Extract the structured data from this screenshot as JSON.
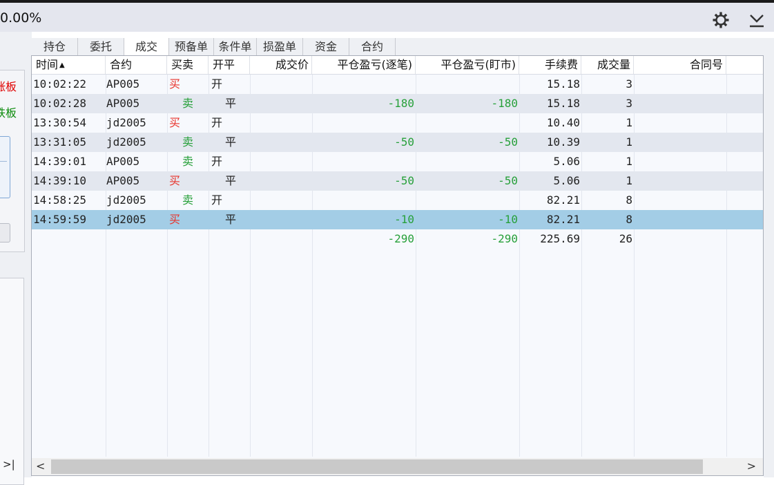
{
  "header": {
    "percent": "0.00%"
  },
  "left_panel": {
    "limit_up": "涨板",
    "limit_down": "跌板",
    "bottom_glyph": ">|"
  },
  "tabs": [
    {
      "label": "持仓",
      "active": false
    },
    {
      "label": "委托",
      "active": false
    },
    {
      "label": "成交",
      "active": true
    },
    {
      "label": "预备单",
      "active": false
    },
    {
      "label": "条件单",
      "active": false
    },
    {
      "label": "损盈单",
      "active": false
    },
    {
      "label": "资金",
      "active": false
    },
    {
      "label": "合约",
      "active": false
    }
  ],
  "table": {
    "columns": [
      "时间",
      "合约",
      "买卖",
      "开平",
      "成交价",
      "平仓盈亏(逐笔)",
      "平仓盈亏(盯市)",
      "手续费",
      "成交量",
      "合同号"
    ],
    "sort_indicator": "▲",
    "rows": [
      {
        "time": "10:02:22",
        "contract": "AP005",
        "side": "买",
        "open_close": "开",
        "price": "",
        "pl_trade": "",
        "pl_mark": "",
        "fee": "15.18",
        "volume": "3",
        "order_no": ""
      },
      {
        "time": "10:02:28",
        "contract": "AP005",
        "side": "卖",
        "open_close": "平",
        "price": "",
        "pl_trade": "-180",
        "pl_mark": "-180",
        "fee": "15.18",
        "volume": "3",
        "order_no": ""
      },
      {
        "time": "13:30:54",
        "contract": "jd2005",
        "side": "买",
        "open_close": "开",
        "price": "",
        "pl_trade": "",
        "pl_mark": "",
        "fee": "10.40",
        "volume": "1",
        "order_no": ""
      },
      {
        "time": "13:31:05",
        "contract": "jd2005",
        "side": "卖",
        "open_close": "平",
        "price": "",
        "pl_trade": "-50",
        "pl_mark": "-50",
        "fee": "10.39",
        "volume": "1",
        "order_no": ""
      },
      {
        "time": "14:39:01",
        "contract": "AP005",
        "side": "卖",
        "open_close": "开",
        "price": "",
        "pl_trade": "",
        "pl_mark": "",
        "fee": "5.06",
        "volume": "1",
        "order_no": ""
      },
      {
        "time": "14:39:10",
        "contract": "AP005",
        "side": "买",
        "open_close": "平",
        "price": "",
        "pl_trade": "-50",
        "pl_mark": "-50",
        "fee": "5.06",
        "volume": "1",
        "order_no": ""
      },
      {
        "time": "14:58:25",
        "contract": "jd2005",
        "side": "卖",
        "open_close": "开",
        "price": "",
        "pl_trade": "",
        "pl_mark": "",
        "fee": "82.21",
        "volume": "8",
        "order_no": ""
      },
      {
        "time": "14:59:59",
        "contract": "jd2005",
        "side": "买",
        "open_close": "平",
        "price": "",
        "pl_trade": "-10",
        "pl_mark": "-10",
        "fee": "82.21",
        "volume": "8",
        "order_no": "",
        "selected": true
      }
    ],
    "totals": {
      "pl_trade": "-290",
      "pl_mark": "-290",
      "fee": "225.69",
      "volume": "26"
    }
  },
  "scrollbar": {
    "left_arrow": "<",
    "right_arrow": ">"
  },
  "colors": {
    "buy": "#e8322a",
    "sell": "#27a03a",
    "selected_row": "#a3cde6",
    "alt_row": "#e3e7ef"
  }
}
